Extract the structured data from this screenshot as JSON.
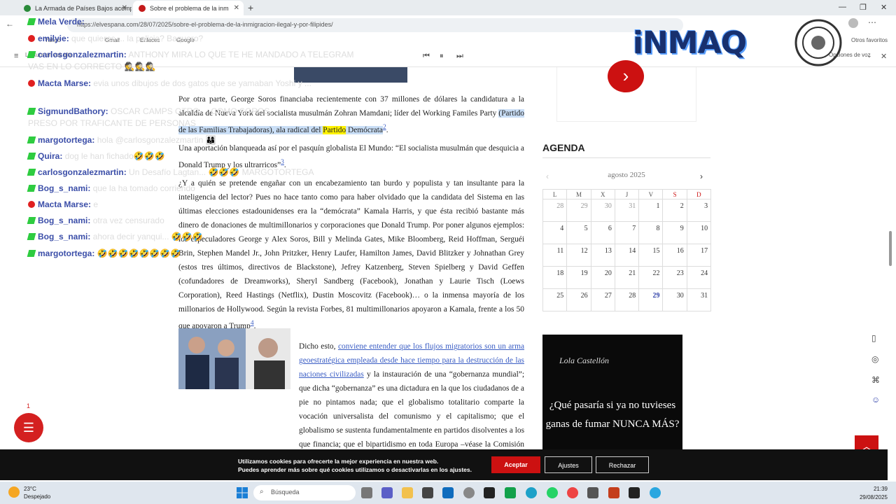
{
  "browser": {
    "tabs": [
      {
        "label": "La Armada de Países Bajos acomp"
      },
      {
        "label": "Sobre el problema de la inm"
      }
    ],
    "url": "https://elvespana.com/28/07/2025/sobre-el-problema-de-la-inmigracion-ilegal-y-por-filipides/",
    "bookmarks": [
      "Yahoo",
      "Gmail",
      "Enlaces",
      "Google"
    ],
    "other_favorites": "Otros favoritos",
    "reader_left": "Lectura en voz alta",
    "reader_right": "Opciones de voz"
  },
  "chat": [
    {
      "user": "Mela Verde:",
      "msg": "",
      "badge": "k"
    },
    {
      "user": "emilyie:",
      "msg": "que quieres ... la policia? Baquero?",
      "badge": "y"
    },
    {
      "user": "carlosgonzalezmartin:",
      "msg": "ANTHONY MIRA LO QUE TE HE MANDADO A TELEGRAM",
      "badge": "k"
    },
    {
      "user": "",
      "msg": "VAS EN LO CORRECTO 🕵🕵🕵",
      "badge": ""
    },
    {
      "user": "Macta Marse:",
      "msg": "evia unos dibujos de dos gatos que se yamaban Yoshi y ... ",
      "badge": "y"
    },
    {
      "user": "SigmundBathory:",
      "msg": "OSCAR CAMPS OTRO ... COMO SOROS,",
      "badge": "k"
    },
    {
      "user": "",
      "msg": "PRESO POR TRAFICANTE DE PERSONAS",
      "badge": ""
    },
    {
      "user": "margotortega:",
      "msg": "hola @carlosgonzalezmartin 👨‍👩‍👦",
      "badge": "k"
    },
    {
      "user": "Quira:",
      "msg": "dog le han fichado🤣🤣🤣",
      "badge": "k"
    },
    {
      "user": "carlosgonzalezmartin:",
      "msg": "Un Desafío Lagtan... 🤣🤣🤣 MARGOTORTEGA",
      "badge": "k"
    },
    {
      "user": "Bog_s_nami:",
      "msg": "que la ha tomado corriendo",
      "badge": "k"
    },
    {
      "user": "Macta Marse:",
      "msg": "e",
      "badge": "y"
    },
    {
      "user": "Bog_s_nami:",
      "msg": "otra vez censurado",
      "badge": "k"
    },
    {
      "user": "Bog_s_nami:",
      "msg": "ahora decir yanqui... 🤣🤣🤣",
      "badge": "k"
    },
    {
      "user": "margotortega:",
      "msg": "🤣🤣🤣🤣🤣🤣🤣🤣",
      "badge": "k"
    }
  ],
  "article": {
    "p1_a": "Por otra parte, George Soros financiaba recientemente con 37 millones de dólares la candidatura a la alcaldía de Nueva York del socialista musulmán Zohran Mamdani; líder del Working Familes Party ",
    "p1_hl1": "(Partido de las Familias Trabajadoras), ala radical del ",
    "p1_hy": "Partido",
    "p1_hl2": " Demócrata",
    "p1_sup": "2",
    "p1_end": ".",
    "p2": "Una aportación blanqueada así por el pasquín globalista El Mundo: “El socialista musulmán que desquicia a Donald Trump y los ultrarricos”",
    "p2_sup": "3",
    "p3": "¿Y a quién se pretende engañar con un encabezamiento tan burdo y populista y tan insultante para la inteligencia del lector? Pues no hace tanto como para haber olvidado que la candidata del Sistema en las últimas elecciones estadounidenses era la “demócrata” Kamala Harris, y que ésta recibió bastante más dinero de donaciones de multimillonarios y corporaciones que Donald Trump. Por poner algunos ejemplos: los especuladores George y Alex Soros, Bill y Melinda Gates, Mike Bloomberg, Reid Hoffman, Serguéi Brin, Stephen Mandel Jr., John Pritzker, Henry Laufer, Hamilton James, David Blitzker y Johnathan Grey (estos tres últimos, directivos de Blackstone), Jefrey Katzenberg, Steven Spielberg y David Geffen (cofundadores de Dreamworks), Sheryl Sandberg (Facebook), Jonathan y Laurie Tisch (Loews Corporation), Reed Hastings (Netflix), Dustin Moscovitz (Facebook)… o la inmensa mayoría de los millonarios de Hollywood. Según la revista Forbes, 81 multimillonarios apoyaron a Kamala, frente a los 50 que apoyaron a Trump",
    "p3_sup": "4",
    "p4_a": "Dicho esto, ",
    "p4_link": "conviene entender que los flujos migratorios son un arma geoestratégica empleada desde hace tiempo para la destrucción de las naciones civilizadas",
    "p4_b": " y la instauración de una “gobernanza mundial”; que dicha “gobernanza” es una dictadura en la que los ciudadanos de a pie no pintamos nada; que el globalismo totalitario comparte la vocación universalista del comunismo y el capitalismo; que el globalismo se sustenta fundamentalmente en partidos disolventes a los que financia; que el bipartidismo en toda Europa –véase la Comisión Europea– gobierna contra los europeos; que la inmigración ilegal masiva genera conflictividad y arruina a los países de origen y"
  },
  "sidebar": {
    "agenda_title": "AGENDA",
    "month": "agosto 2025",
    "weekdays": [
      "L",
      "M",
      "X",
      "J",
      "V",
      "S",
      "D"
    ],
    "weeks": [
      [
        "28",
        "29",
        "30",
        "31",
        "1",
        "2",
        "3"
      ],
      [
        "4",
        "5",
        "6",
        "7",
        "8",
        "9",
        "10"
      ],
      [
        "11",
        "12",
        "13",
        "14",
        "15",
        "16",
        "17"
      ],
      [
        "18",
        "19",
        "20",
        "21",
        "22",
        "23",
        "24"
      ],
      [
        "25",
        "26",
        "27",
        "28",
        "29",
        "30",
        "31"
      ]
    ],
    "today": "29",
    "ad_signature": "Lola Castellón",
    "ad_text": "¿Qué pasaría si ya no tuvieses ganas de fumar NUNCA MÁS?"
  },
  "logo_text": "iNMAQ",
  "chat_count": "1",
  "cookie": {
    "line1": "Utilizamos cookies para ofrecerte la mejor experiencia en nuestra web.",
    "line2": "Puedes aprender más sobre qué cookies utilizamos o desactivarlas en los ajustes.",
    "accept": "Aceptar",
    "settings": "Ajustes",
    "reject": "Rechazar"
  },
  "taskbar": {
    "temp": "23°C",
    "weather": "Despejado",
    "search": "Búsqueda",
    "time": "21:39",
    "date": "29/08/2025"
  },
  "colors": {
    "accent_red": "#cc1111",
    "chat_user": "#3b4ea8",
    "link": "#3a5dc4"
  }
}
